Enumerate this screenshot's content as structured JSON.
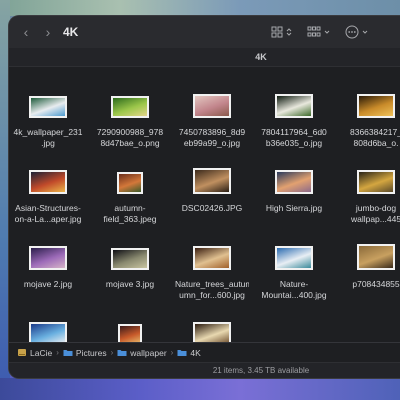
{
  "window": {
    "title": "4K",
    "tab_label": "4K",
    "nav": {
      "back": "‹",
      "forward": "›"
    }
  },
  "toolbar": {
    "icons": [
      "grid-view-icon",
      "group-icon",
      "more-icon"
    ],
    "chevron": "⌃",
    "dropdown_arrow": "⌄"
  },
  "files": [
    {
      "name_line1": "4k_wallpaper_231",
      "name_line2": ".jpg",
      "colors": [
        "#1d5a3a",
        "#e8ecef",
        "#4d9bd0"
      ]
    },
    {
      "name_line1": "7290900988_978",
      "name_line2": "8d47bae_o.png",
      "colors": [
        "#2b6a1c",
        "#9bc64a",
        "#e4d58a"
      ]
    },
    {
      "name_line1": "7450783896_8d9",
      "name_line2": "eb99a99_o.jpg",
      "colors": [
        "#e3c7c1",
        "#c2858c",
        "#8b5a4c"
      ]
    },
    {
      "name_line1": "7804117964_6d0",
      "name_line2": "b36e035_o.jpg",
      "colors": [
        "#0e1a10",
        "#e8e8dd",
        "#3d6a2a"
      ]
    },
    {
      "name_line1": "8366384217_",
      "name_line2": "808d6ba_o.",
      "colors": [
        "#2a1a08",
        "#c98b2a",
        "#f0c25a"
      ]
    },
    {
      "name_line1": "Asian-Structures-",
      "name_line2": "on-a-La...aper.jpg",
      "colors": [
        "#1c2236",
        "#c14a2a",
        "#ebb44a"
      ]
    },
    {
      "name_line1": "autumn-",
      "name_line2": "field_363.jpeg",
      "colors": [
        "#6b2d1a",
        "#d3783a",
        "#3a5a2a"
      ]
    },
    {
      "name_line1": "DSC02426.JPG",
      "name_line2": "",
      "colors": [
        "#3b2a1c",
        "#c09060",
        "#2a1e14"
      ]
    },
    {
      "name_line1": "High Sierra.jpg",
      "name_line2": "",
      "colors": [
        "#2a3a5c",
        "#e2a170",
        "#8c6a8a"
      ]
    },
    {
      "name_line1": "jumbo-dog",
      "name_line2": "wallpap...445",
      "colors": [
        "#2a2418",
        "#d4a640",
        "#5a4a2a"
      ]
    },
    {
      "name_line1": "mojave 2.jpg",
      "name_line2": "",
      "colors": [
        "#2a1e4a",
        "#9c6ab8",
        "#d6b4c8"
      ]
    },
    {
      "name_line1": "mojave 3.jpg",
      "name_line2": "",
      "colors": [
        "#0e0e14",
        "#8a8a70",
        "#c8c4a0"
      ]
    },
    {
      "name_line1": "Nature_trees_autum",
      "name_line2": "umn_for...600.jpg",
      "colors": [
        "#3a1e10",
        "#e0c090",
        "#a0602a"
      ]
    },
    {
      "name_line1": "Nature-",
      "name_line2": "Mountai...400.jpg",
      "colors": [
        "#2a6ab0",
        "#e8eef4",
        "#3a8a9a"
      ]
    },
    {
      "name_line1": "p708434855",
      "name_line2": "",
      "colors": [
        "#8a6a3a",
        "#c8a060",
        "#3a2a1a"
      ]
    },
    {
      "name_line1": "",
      "name_line2": "",
      "colors": [
        "#1a3a8a",
        "#6ab0e0",
        "#f0f0f0"
      ]
    },
    {
      "name_line1": "",
      "name_line2": "",
      "colors": [
        "#3a1a1a",
        "#c85a2a",
        "#e8c070"
      ]
    },
    {
      "name_line1": "",
      "name_line2": "",
      "colors": [
        "#2a1a0e",
        "#e8d8b0",
        "#6a4a2a"
      ]
    }
  ],
  "breadcrumb": [
    {
      "label": "LaCie",
      "icon": "external-drive-icon"
    },
    {
      "label": "Pictures",
      "icon": "folder-icon"
    },
    {
      "label": "wallpaper",
      "icon": "folder-icon"
    },
    {
      "label": "4K",
      "icon": "folder-icon"
    }
  ],
  "status": "21 items, 3.45 TB available",
  "accent": "#4a8fd9"
}
